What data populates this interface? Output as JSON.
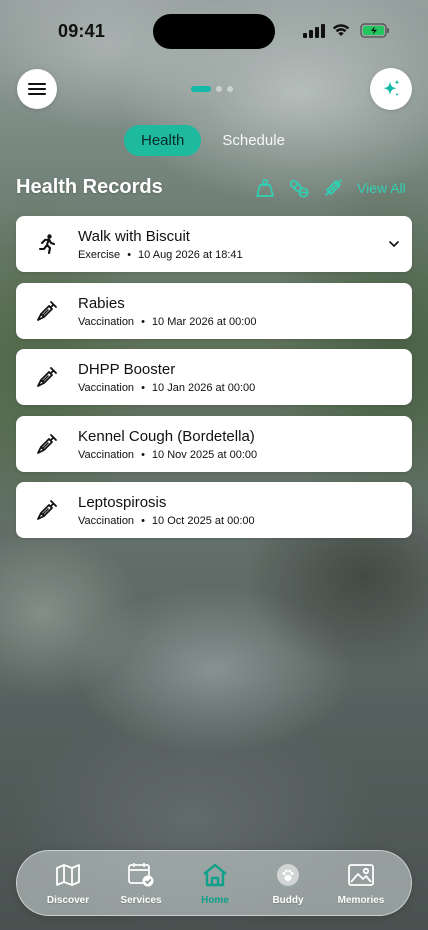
{
  "status_bar": {
    "time": "09:41"
  },
  "colors": {
    "accent": "#1dbaa0",
    "accent_text": "#2fd1b3",
    "card": "#ffffff"
  },
  "tabs": [
    {
      "label": "Health",
      "active": true
    },
    {
      "label": "Schedule",
      "active": false
    }
  ],
  "section": {
    "title": "Health Records",
    "actions": [
      "scale-icon",
      "pill-icon",
      "syringe-icon"
    ],
    "view_all": "View All"
  },
  "records": [
    {
      "title": "Walk with Biscuit",
      "category": "Exercise",
      "date": "10 Aug 2026 at 18:41",
      "icon": "running-icon",
      "expandable": true
    },
    {
      "title": "Rabies",
      "category": "Vaccination",
      "date": "10 Mar 2026 at 00:00",
      "icon": "syringe-icon"
    },
    {
      "title": "DHPP Booster",
      "category": "Vaccination",
      "date": "10 Jan 2026 at 00:00",
      "icon": "syringe-icon"
    },
    {
      "title": "Kennel Cough (Bordetella)",
      "category": "Vaccination",
      "date": "10 Nov 2025 at 00:00",
      "icon": "syringe-icon"
    },
    {
      "title": "Leptospirosis",
      "category": "Vaccination",
      "date": "10 Oct 2025 at 00:00",
      "icon": "syringe-icon"
    }
  ],
  "nav": {
    "items": [
      {
        "label": "Discover",
        "icon": "map-icon"
      },
      {
        "label": "Services",
        "icon": "calendar-check-icon"
      },
      {
        "label": "Home",
        "icon": "home-icon",
        "active": true
      },
      {
        "label": "Buddy",
        "icon": "paw-icon"
      },
      {
        "label": "Memories",
        "icon": "image-icon"
      }
    ]
  }
}
